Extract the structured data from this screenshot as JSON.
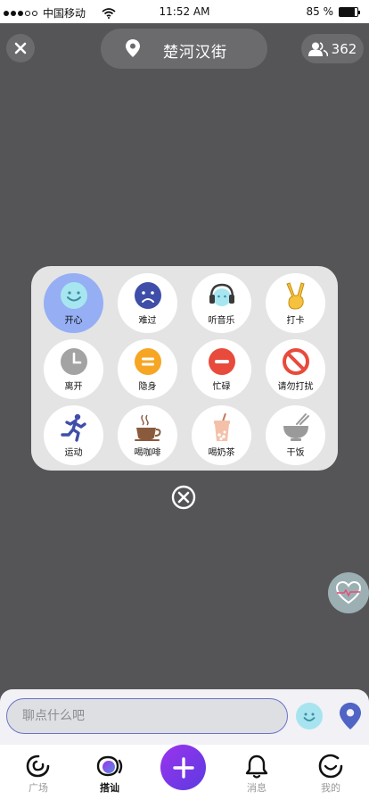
{
  "status_bar": {
    "carrier": "中国移动",
    "time": "11:52 AM",
    "battery": "85 %",
    "battery_level": 0.85
  },
  "top_bar": {
    "location_title": "楚河汉街",
    "people_count": "362"
  },
  "status_panel": {
    "options": [
      {
        "label": "开心",
        "icon": "smile-icon",
        "selected": true
      },
      {
        "label": "难过",
        "icon": "sad-face-icon",
        "selected": false
      },
      {
        "label": "听音乐",
        "icon": "headphones-icon",
        "selected": false
      },
      {
        "label": "打卡",
        "icon": "victory-hand-icon",
        "selected": false
      },
      {
        "label": "离开",
        "icon": "clock-icon",
        "selected": false
      },
      {
        "label": "隐身",
        "icon": "equals-icon",
        "selected": false
      },
      {
        "label": "忙碌",
        "icon": "minus-icon",
        "selected": false
      },
      {
        "label": "请勿打扰",
        "icon": "no-entry-icon",
        "selected": false
      },
      {
        "label": "运动",
        "icon": "running-icon",
        "selected": false
      },
      {
        "label": "喝咖啡",
        "icon": "coffee-icon",
        "selected": false
      },
      {
        "label": "喝奶茶",
        "icon": "bubble-tea-icon",
        "selected": false
      },
      {
        "label": "干饭",
        "icon": "rice-bowl-icon",
        "selected": false
      }
    ]
  },
  "chat": {
    "placeholder": "聊点什么吧"
  },
  "tab_bar": {
    "tabs": [
      {
        "label": "广场",
        "icon": "plaza-icon",
        "active": false
      },
      {
        "label": "搭讪",
        "icon": "chat-bubble-icon",
        "active": true
      },
      {
        "label": "消息",
        "icon": "bell-icon",
        "active": false
      },
      {
        "label": "我的",
        "icon": "profile-smile-icon",
        "active": false
      }
    ]
  },
  "colors": {
    "background": "#555557",
    "accent_purple": "#7b3be8",
    "selected_chip": "#95aef4",
    "input_border": "#6a72c7"
  }
}
